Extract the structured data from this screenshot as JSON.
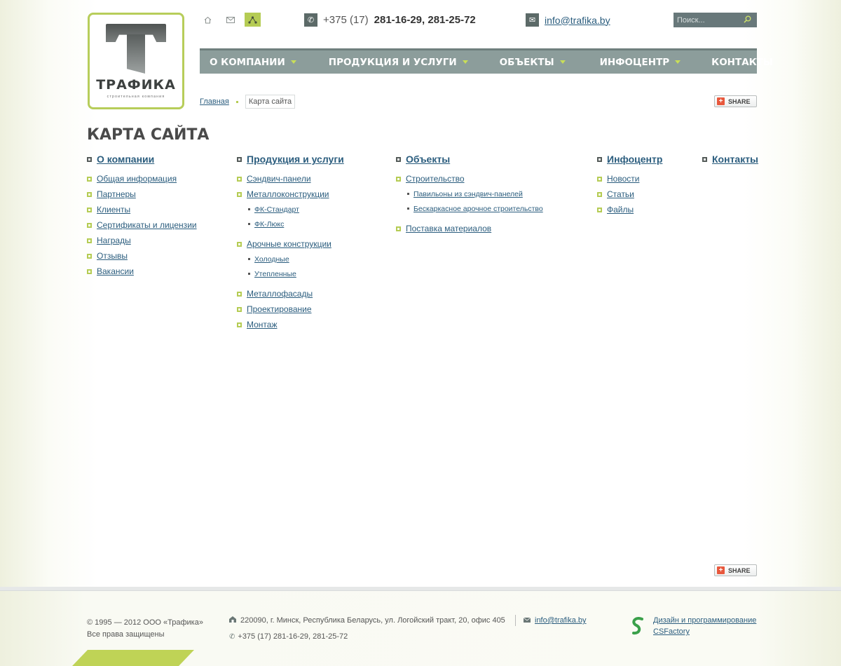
{
  "logo": {
    "name": "ТРАФИКА",
    "subtitle": "строительная компания"
  },
  "top_icons": [
    {
      "icon": "home-icon",
      "glyph": "⌂"
    },
    {
      "icon": "mail-icon",
      "glyph": "✉"
    },
    {
      "icon": "sitemap-icon",
      "glyph": "⋀"
    }
  ],
  "header": {
    "phone_prefix": "+375 (17)",
    "phone_numbers": "281-16-29, 281-25-72",
    "email": "info@trafika.by",
    "search_placeholder": "Поиск..."
  },
  "nav": [
    {
      "label": "О КОМПАНИИ",
      "dropdown": true
    },
    {
      "label": "ПРОДУКЦИЯ И УСЛУГИ",
      "dropdown": true
    },
    {
      "label": "ОБЪЕКТЫ",
      "dropdown": true
    },
    {
      "label": "ИНФОЦЕНТР",
      "dropdown": true
    },
    {
      "label": "КОНТАКТЫ",
      "dropdown": false
    }
  ],
  "breadcrumb": {
    "home": "Главная",
    "current": "Карта сайта"
  },
  "share_label": "SHARE",
  "page_title": "КАРТА САЙТА",
  "sitemap": [
    {
      "title": "О компании",
      "items": [
        {
          "label": "Общая информация"
        },
        {
          "label": "Партнеры"
        },
        {
          "label": "Клиенты"
        },
        {
          "label": "Сертификаты и лицензии"
        },
        {
          "label": "Награды"
        },
        {
          "label": "Отзывы"
        },
        {
          "label": "Вакансии"
        }
      ]
    },
    {
      "title": "Продукция и услуги",
      "items": [
        {
          "label": "Сэндвич-панели"
        },
        {
          "label": "Металлоконструкции",
          "children": [
            "ФК-Стандарт",
            "ФК-Люкс"
          ]
        },
        {
          "label": "Арочные конструкции",
          "children": [
            "Холодные",
            "Утепленные"
          ]
        },
        {
          "label": "Металлофасады"
        },
        {
          "label": "Проектирование"
        },
        {
          "label": "Монтаж"
        }
      ]
    },
    {
      "title": "Объекты",
      "items": [
        {
          "label": "Строительство",
          "children": [
            "Павильоны из сэндвич-панелей",
            "Бескаркасное арочное строительство"
          ]
        },
        {
          "label": "Поставка материалов"
        }
      ]
    },
    {
      "title": "Инфоцентр",
      "items": [
        {
          "label": "Новости"
        },
        {
          "label": "Статьи"
        },
        {
          "label": "Файлы"
        }
      ]
    },
    {
      "title": "Контакты",
      "items": []
    }
  ],
  "footer": {
    "copyright": "© 1995 — 2012 ООО «Трафика»",
    "rights": "Все права защищены",
    "address": "220090, г. Минск, Республика Беларусь, ул. Логойский тракт, 20, офис 405",
    "email": "info@trafika.by",
    "phone": "+375 (17) 281-16-29, 281-25-72",
    "credit_line1": "Дизайн и программирование",
    "credit_line2": "CSFactory"
  },
  "colors": {
    "accent_green": "#b5cc54",
    "nav_bg": "#8c9d9b",
    "link": "#2b5d7e"
  }
}
